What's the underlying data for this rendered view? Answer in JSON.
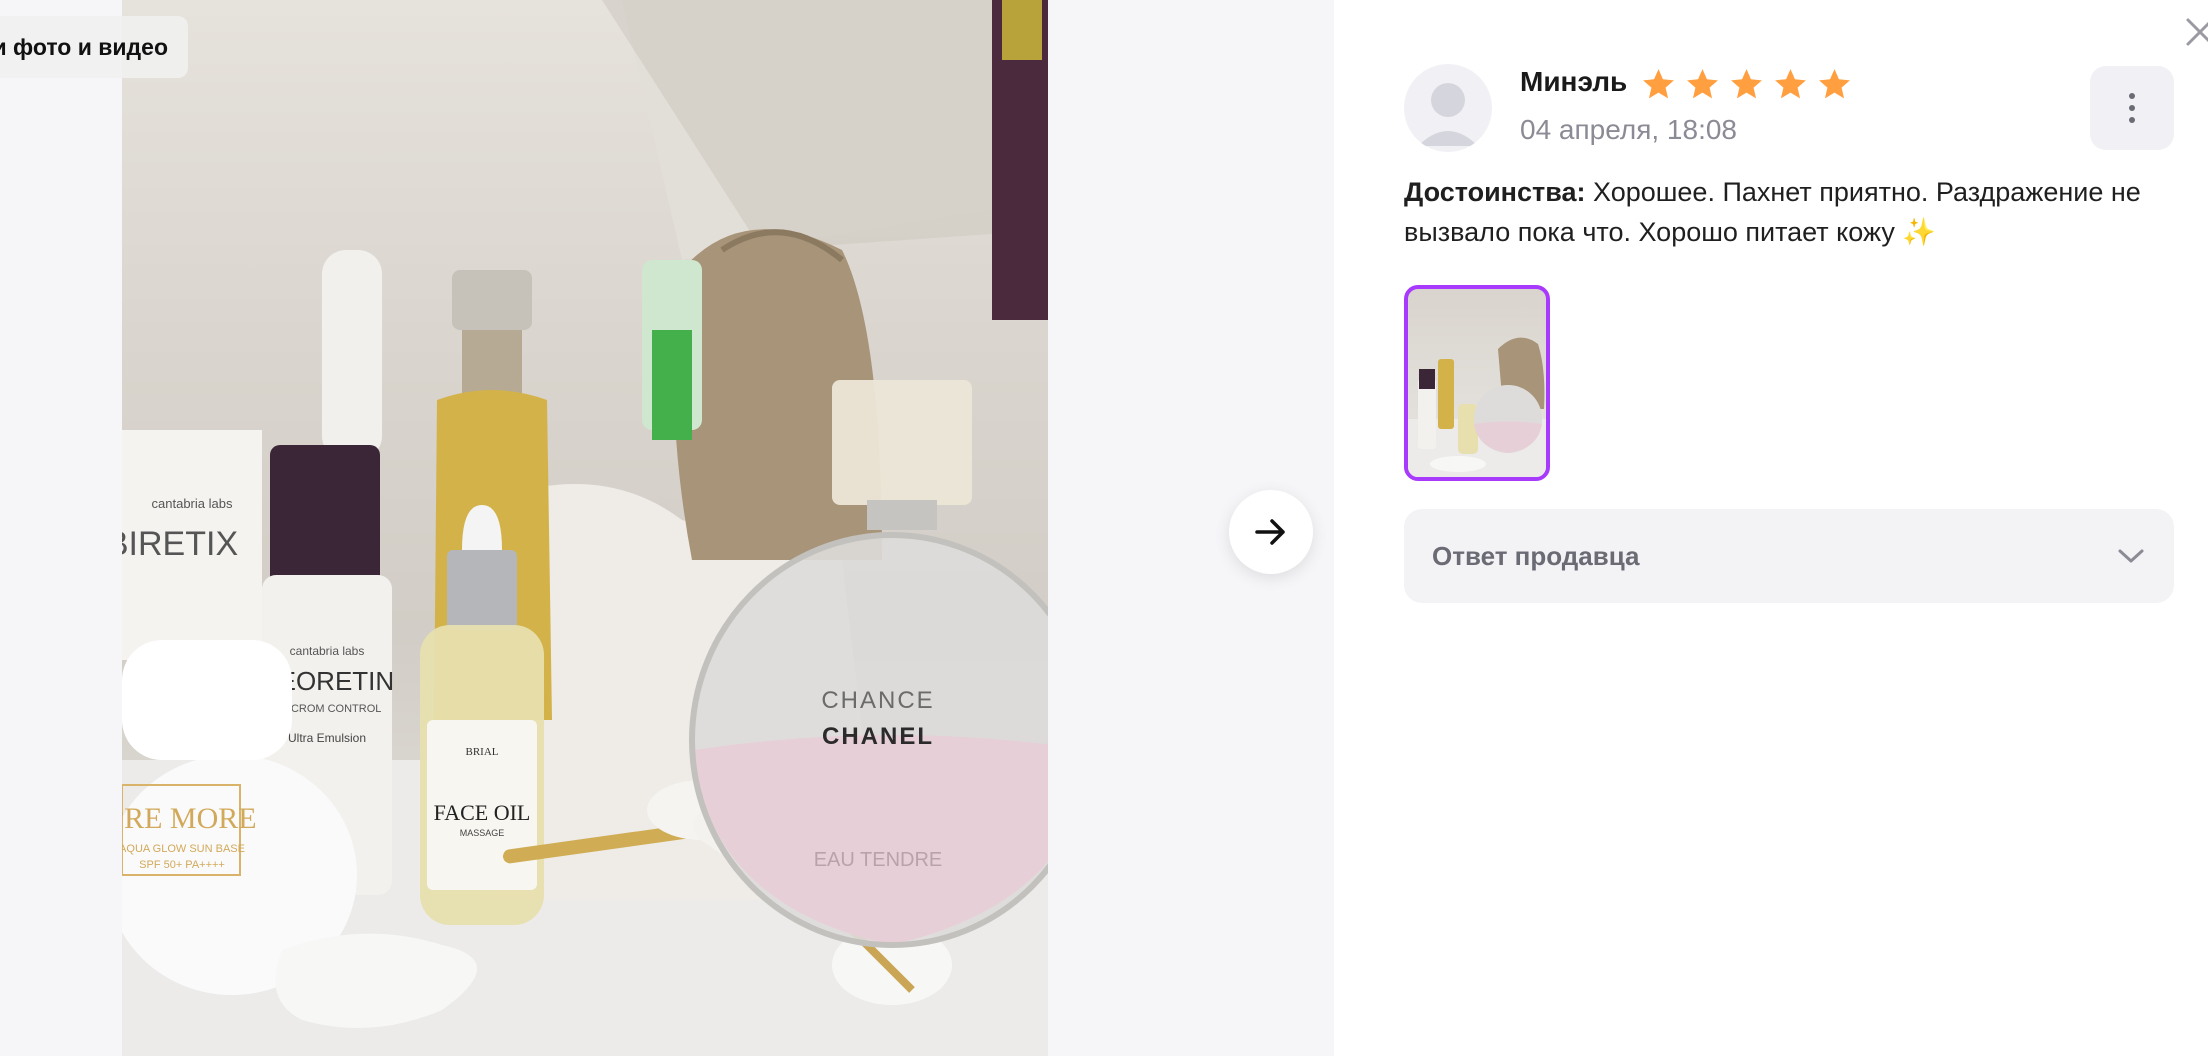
{
  "viewer": {
    "all_media_label": "и фото и видео",
    "next_icon": "arrow-right-icon",
    "photo_labels": {
      "jar_brand": "PRE MORE",
      "jar_sub": "AQUA GLOW SUN BASE",
      "jar_spf": "SPF 50+ PA++++",
      "sachet_brand": "cantabria labs",
      "sachet_name": "BIRETIX",
      "bottle_brand": "cantabria labs",
      "bottle_name": "NEORETIN",
      "bottle_sub": "DISCROM CONTROL",
      "bottle_line": "Ultra Emulsion",
      "oil_brand": "BRIAL",
      "oil_name": "FACE OIL",
      "oil_sub": "MASSAGE",
      "perfume_line1": "CHANCE",
      "perfume_line2": "CHANEL",
      "perfume_line3": "EAU TENDRE"
    }
  },
  "review": {
    "author": "Минэль",
    "rating": 5,
    "rating_max": 5,
    "date": "04 апреля, 18:08",
    "pros_label": "Достоинства:",
    "pros_text": "Хорошее. Пахнет приятно. Раздражение не вызвало пока что. Хорошо питает кожу ✨",
    "more_icon": "more-vertical-icon",
    "seller_reply_label": "Ответ продавца",
    "seller_reply_icon": "chevron-down-icon"
  },
  "colors": {
    "star": "#ff9f40",
    "thumb_border": "#a73afd",
    "muted_text": "#8b8b95"
  }
}
